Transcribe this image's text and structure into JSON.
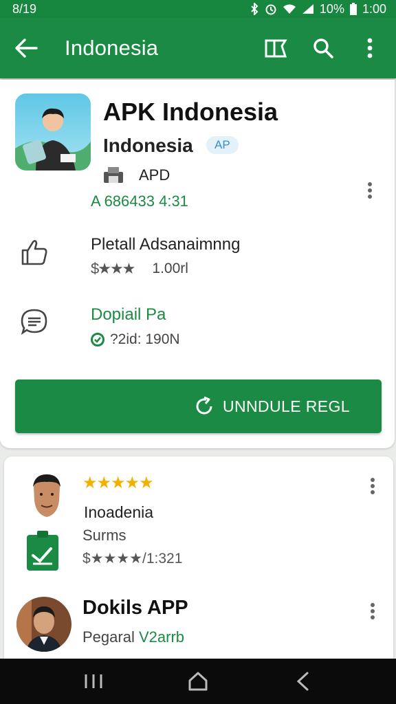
{
  "status": {
    "time": "8/19",
    "battery": "10%",
    "clock": "1:00"
  },
  "appbar": {
    "title": "Indonesia"
  },
  "app": {
    "name": "APK Indonesia",
    "developer": "Indonesia",
    "badge": "AP",
    "apd_label": "APD",
    "meta": "A 686433 4:31"
  },
  "rows": [
    {
      "title": "Pletall Adsanaimnng",
      "stars_text": "$★★★",
      "value": "1.00rl"
    },
    {
      "title": "Dopiail Pa",
      "sub": "?2id: 190N"
    }
  ],
  "install_button": {
    "label": "UNNDULE REGL"
  },
  "review": {
    "stars": "★★★★★",
    "title": "Inoadenia",
    "sub": "Surms",
    "rating_line": "$★★★★/1:321"
  },
  "review2": {
    "title": "Dokils APP",
    "sub_prefix": "Pegaral",
    "sub_green": "V2arrb"
  },
  "colors": {
    "primary": "#1a8a44",
    "status_bar": "#17863f",
    "star_gold": "#f2b100"
  }
}
